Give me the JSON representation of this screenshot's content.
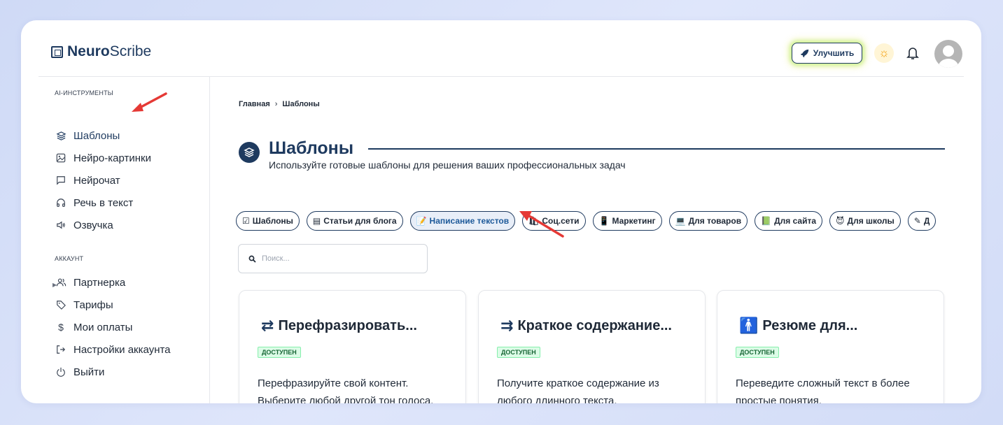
{
  "app": {
    "logo_bold": "Neuro",
    "logo_rest": "Scribe"
  },
  "header": {
    "upgrade_label": "Улучшить",
    "theme_icon": "sun-icon",
    "bell_icon": "bell-icon",
    "avatar_icon": "user-avatar-icon"
  },
  "sidebar": {
    "section_tools": "AI-ИНСТРУМЕНТЫ",
    "tools": [
      {
        "label": "Шаблоны",
        "icon": "layers-icon"
      },
      {
        "label": "Нейро-картинки",
        "icon": "image-icon"
      },
      {
        "label": "Нейрочат",
        "icon": "chat-icon"
      },
      {
        "label": "Речь в текст",
        "icon": "headphones-icon"
      },
      {
        "label": "Озвучка",
        "icon": "speaker-icon"
      }
    ],
    "section_account": "АККАУНТ",
    "account": [
      {
        "label": "Партнерка",
        "icon": "users-icon"
      },
      {
        "label": "Тарифы",
        "icon": "tag-icon"
      },
      {
        "label": "Мои оплаты",
        "icon": "dollar-icon"
      },
      {
        "label": "Настройки аккаунта",
        "icon": "logout-arrow-icon"
      },
      {
        "label": "Выйти",
        "icon": "power-icon"
      }
    ]
  },
  "breadcrumb": {
    "home": "Главная",
    "separator": "›",
    "current": "Шаблоны"
  },
  "page": {
    "title": "Шаблоны",
    "subtitle": "Используйте готовые шаблоны для решения ваших профессиональных задач"
  },
  "tabs": [
    {
      "label": "Шаблоны",
      "icon": "☑"
    },
    {
      "label": "Статьи для блога",
      "icon": "▤"
    },
    {
      "label": "Написание текстов",
      "icon": "📝",
      "active": true
    },
    {
      "label": "Соц.сети",
      "icon": "🛍"
    },
    {
      "label": "Маркетинг",
      "icon": "📱"
    },
    {
      "label": "Для товаров",
      "icon": "💻"
    },
    {
      "label": "Для сайта",
      "icon": "📗"
    },
    {
      "label": "Для школы",
      "icon": "😈"
    },
    {
      "label": "Д",
      "icon": "✎"
    }
  ],
  "search": {
    "placeholder": "Поиск..."
  },
  "cards": [
    {
      "title": "Перефразировать...",
      "badge": "ДОСТУПЕН",
      "desc": "Перефразируйте свой контент. Выберите любой другой тон голоса.",
      "icon": "refresh-arrows-icon"
    },
    {
      "title": "Краткое содержание...",
      "badge": "ДОСТУПЕН",
      "desc": "Получите краткое содержание из любого длинного текста.",
      "icon": "summary-icon"
    },
    {
      "title": "Резюме для...",
      "badge": "ДОСТУПЕН",
      "desc": "Переведите сложный текст в более простые понятия.",
      "icon": "child-icon"
    }
  ],
  "colors": {
    "brand": "#1e3a5f",
    "badge_bg": "#dcfce7",
    "annotation_arrow": "#e53935"
  }
}
